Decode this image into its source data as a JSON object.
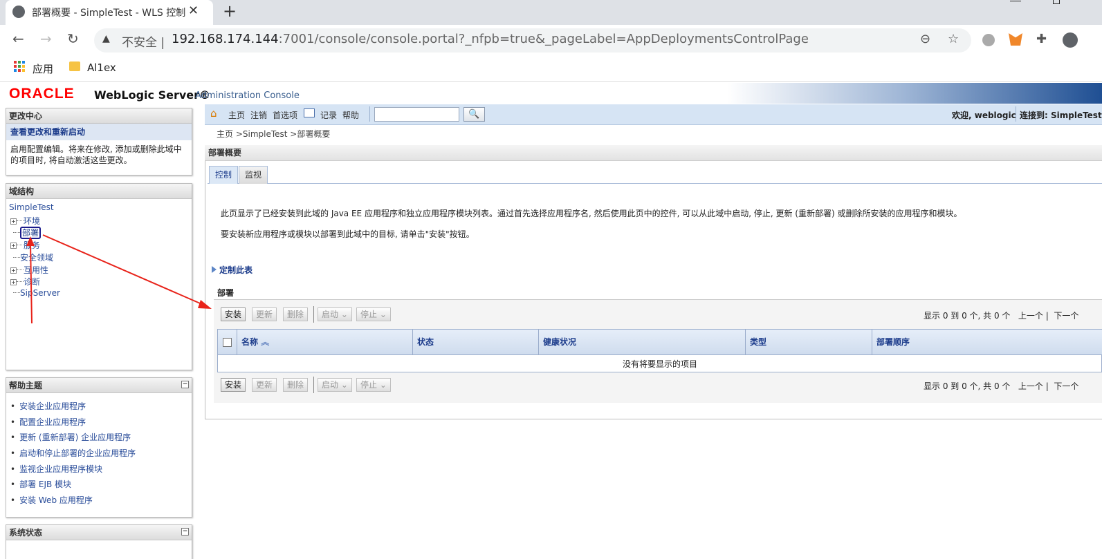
{
  "browser": {
    "tab_title": "部署概要 - SimpleTest - WLS 控制台",
    "new_tab": "+",
    "close": "✕",
    "insecure_label": "不安全",
    "url_host": "192.168.174.144",
    "url_rest": ":7001/console/console.portal?_nfpb=true&_pageLabel=AppDeploymentsControlPage",
    "bookmarks": [
      {
        "label": "应用",
        "icon": "apps-grid-icon"
      },
      {
        "label": "Al1ex",
        "icon": "folder-icon"
      }
    ]
  },
  "header": {
    "oracle": "ORACLE",
    "product": "WebLogic Server®",
    "subtitle": "Administration Console"
  },
  "change_center": {
    "title": "更改中心",
    "link": "查看更改和重新启动",
    "desc": "启用配置编辑。将来在修改, 添加或删除此域中的项目时, 将自动激活这些更改。"
  },
  "domain_structure": {
    "title": "域结构",
    "root": "SimpleTest",
    "items": [
      {
        "label": "环境",
        "expandable": true
      },
      {
        "label": "部署",
        "expandable": false,
        "selected": true
      },
      {
        "label": "服务",
        "expandable": true
      },
      {
        "label": "安全领域",
        "expandable": false
      },
      {
        "label": "互用性",
        "expandable": true
      },
      {
        "label": "诊断",
        "expandable": true
      },
      {
        "label": "SipServer",
        "expandable": false
      }
    ]
  },
  "help_topics": {
    "title": "帮助主题",
    "items": [
      "安装企业应用程序",
      "配置企业应用程序",
      "更新 (重新部署) 企业应用程序",
      "启动和停止部署的企业应用程序",
      "监视企业应用程序模块",
      "部署 EJB 模块",
      "安装 Web 应用程序"
    ]
  },
  "system_status": {
    "title": "系统状态"
  },
  "navbar": {
    "home": "主页",
    "logout": "注销",
    "preferences": "首选项",
    "record": "记录",
    "help": "帮助",
    "welcome": "欢迎, weblogic",
    "connected": "连接到: SimpleTest"
  },
  "breadcrumb": "主页 >SimpleTest >部署概要",
  "page": {
    "title": "部署概要",
    "tabs": [
      "控制",
      "监视"
    ],
    "desc1": "此页显示了已经安装到此域的 Java EE 应用程序和独立应用程序模块列表。通过首先选择应用程序名, 然后使用此页中的控件, 可以从此域中启动, 停止, 更新 (重新部署) 或删除所安装的应用程序和模块。",
    "desc2": "要安装新应用程序或模块以部署到此域中的目标, 请单击\"安装\"按钮。",
    "customize": "定制此表"
  },
  "deployments": {
    "title": "部署",
    "buttons": {
      "install": "安装",
      "update": "更新",
      "delete": "删除",
      "start": "启动",
      "stop": "停止"
    },
    "pager": {
      "summary": "显示 0 到 0 个, 共 0 个",
      "prev": "上一个",
      "next": "下一个"
    },
    "columns": [
      "名称",
      "状态",
      "健康状况",
      "类型",
      "部署顺序"
    ],
    "empty": "没有将要显示的项目"
  },
  "colors": {
    "oracle_red": "#ff0000",
    "nav_blue": "#d6e4f4",
    "link_blue": "#2a4d9a",
    "arrow_red": "#e8231a"
  }
}
